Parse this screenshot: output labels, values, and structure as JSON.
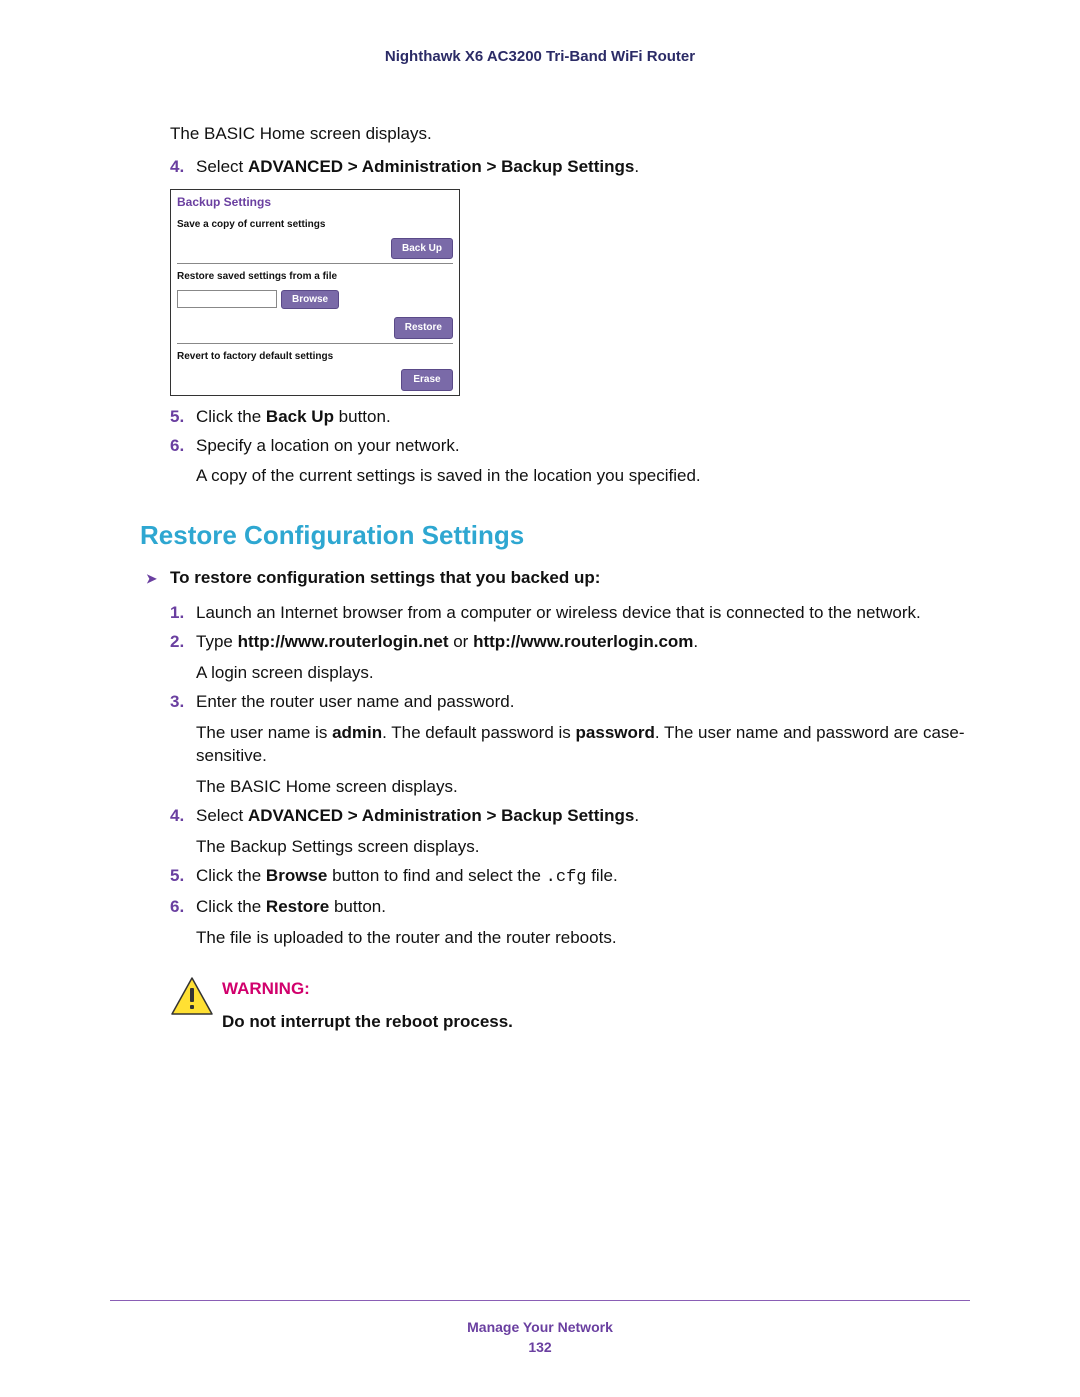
{
  "header": {
    "product": "Nighthawk X6 AC3200 Tri-Band WiFi Router"
  },
  "preSteps": {
    "intro": "The BASIC Home screen displays.",
    "step4": {
      "num": "4.",
      "prefix": "Select ",
      "path": "ADVANCED > Administration > Backup Settings",
      "suffix": "."
    }
  },
  "panel": {
    "title": "Backup Settings",
    "section1_label": "Save a copy of current settings",
    "backup_btn": "Back Up",
    "section2_label": "Restore saved settings from a file",
    "browse_btn": "Browse",
    "restore_btn": "Restore",
    "section3_label": "Revert to factory default settings",
    "erase_btn": "Erase"
  },
  "postSteps": {
    "step5": {
      "num": "5.",
      "prefix": "Click the ",
      "bold": "Back Up",
      "suffix": " button."
    },
    "step6": {
      "num": "6.",
      "text": "Specify a location on your network.",
      "sub": "A copy of the current settings is saved in the location you specified."
    }
  },
  "section": {
    "heading": "Restore Configuration Settings",
    "subtask": "To restore configuration settings that you backed up:",
    "s1": {
      "num": "1.",
      "text": "Launch an Internet browser from a computer or wireless device that is connected to the network."
    },
    "s2": {
      "num": "2.",
      "prefix": "Type ",
      "b1": "http://www.routerlogin.net",
      "mid": " or ",
      "b2": "http://www.routerlogin.com",
      "suffix": ".",
      "sub": "A login screen displays."
    },
    "s3": {
      "num": "3.",
      "text": "Enter the router user name and password.",
      "sub1_a": "The user name is ",
      "sub1_b1": "admin",
      "sub1_c": ". The default password is ",
      "sub1_b2": "password",
      "sub1_d": ". The user name and password are case-sensitive.",
      "sub2": "The BASIC Home screen displays."
    },
    "s4": {
      "num": "4.",
      "prefix": "Select ",
      "path": "ADVANCED > Administration > Backup Settings",
      "suffix": ".",
      "sub": "The Backup Settings screen displays."
    },
    "s5": {
      "num": "5.",
      "prefix": "Click the ",
      "b1": "Browse",
      "mid": " button to find and select the ",
      "mono": ".cfg",
      "suffix": " file."
    },
    "s6": {
      "num": "6.",
      "prefix": "Click the ",
      "b1": "Restore",
      "suffix": " button.",
      "sub": "The file is uploaded to the router and the router reboots."
    }
  },
  "warning": {
    "label": "WARNING:",
    "text": "Do not interrupt the reboot process."
  },
  "footer": {
    "chapter": "Manage Your Network",
    "page": "132"
  }
}
